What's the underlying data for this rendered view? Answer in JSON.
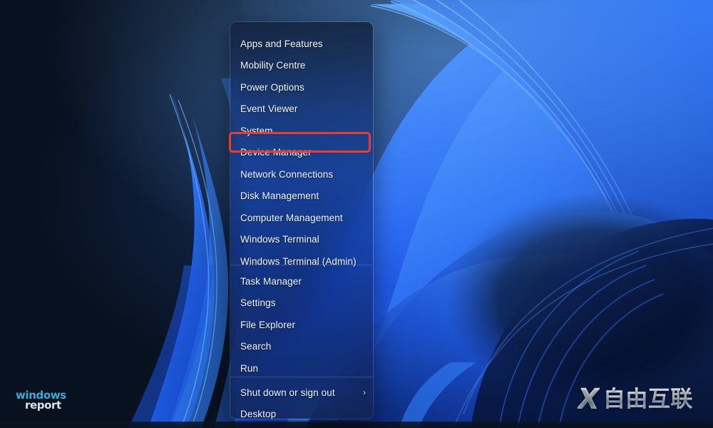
{
  "desktop": {
    "wallpaper_name": "windows-11-bloom-wallpaper",
    "background_dark_color": "#0a1524",
    "accent_blue": "#1f5fe0",
    "bright_blue": "#2f7cf6",
    "deep_blue": "#0d1f57"
  },
  "taskbar": {
    "name": "taskbar-strip",
    "color": "#0c1422"
  },
  "winx_menu": {
    "name": "Win + X quick link menu",
    "groups": [
      {
        "items": [
          {
            "label": "Apps and Features",
            "has_submenu": false
          },
          {
            "label": "Mobility Centre",
            "has_submenu": false
          },
          {
            "label": "Power Options",
            "has_submenu": false
          },
          {
            "label": "Event Viewer",
            "has_submenu": false
          },
          {
            "label": "System",
            "has_submenu": false
          },
          {
            "label": "Device Manager",
            "has_submenu": false
          },
          {
            "label": "Network Connections",
            "has_submenu": false
          },
          {
            "label": "Disk Management",
            "has_submenu": false
          },
          {
            "label": "Computer Management",
            "has_submenu": false
          },
          {
            "label": "Windows Terminal",
            "has_submenu": false
          },
          {
            "label": "Windows Terminal (Admin)",
            "has_submenu": false
          }
        ]
      },
      {
        "items": [
          {
            "label": "Task Manager",
            "has_submenu": false
          },
          {
            "label": "Settings",
            "has_submenu": false
          },
          {
            "label": "File Explorer",
            "has_submenu": false
          },
          {
            "label": "Search",
            "has_submenu": false
          },
          {
            "label": "Run",
            "has_submenu": false
          }
        ]
      },
      {
        "items": [
          {
            "label": "Shut down or sign out",
            "has_submenu": true,
            "submenu_glyph": "›"
          },
          {
            "label": "Desktop",
            "has_submenu": false
          }
        ]
      }
    ]
  },
  "annotation": {
    "name": "device-manager-highlight",
    "target_label": "Device Manager",
    "color": "#ef3b2d"
  },
  "watermarks": {
    "windows_report": {
      "line1": "windows",
      "line2": "report",
      "line1_color": "#3fb8e0",
      "line2_color": "#eef4f8"
    },
    "site": {
      "mark": "X",
      "text": "自由互联"
    }
  }
}
